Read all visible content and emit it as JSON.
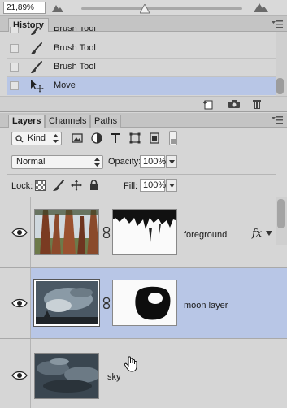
{
  "topbar": {
    "zoom_value": "21,89%",
    "icons": [
      "navigator-mountain-small-icon",
      "zoom-slider",
      "navigator-mountain-large-icon"
    ]
  },
  "history": {
    "tab_label": "History",
    "items": [
      {
        "label": "Brush Tool",
        "icon": "brush-icon",
        "selected": false
      },
      {
        "label": "Brush Tool",
        "icon": "brush-icon",
        "selected": false
      },
      {
        "label": "Brush Tool",
        "icon": "brush-icon",
        "selected": false
      },
      {
        "label": "Move",
        "icon": "move-icon",
        "selected": true
      }
    ],
    "footer_icons": [
      "new-document-from-state-icon",
      "snapshot-camera-icon",
      "trash-icon"
    ]
  },
  "layers": {
    "tabs": [
      {
        "label": "Layers",
        "active": true
      },
      {
        "label": "Channels",
        "active": false
      },
      {
        "label": "Paths",
        "active": false
      }
    ],
    "filter_kind_label": "Kind",
    "filter_icons": [
      "pixel-filter-icon",
      "adjustment-filter-icon",
      "type-filter-icon",
      "shape-filter-icon",
      "smart-object-filter-icon"
    ],
    "blend_mode": "Normal",
    "opacity_label": "Opacity:",
    "opacity_value": "100%",
    "lock_label": "Lock:",
    "lock_icons": [
      "lock-transparent-icon",
      "lock-image-icon",
      "lock-position-icon",
      "lock-all-icon"
    ],
    "fill_label": "Fill:",
    "fill_value": "100%",
    "list": [
      {
        "name": "foreground",
        "selected": false,
        "has_mask": true,
        "fx": "fx"
      },
      {
        "name": "moon layer",
        "selected": true,
        "has_mask": true,
        "fx": ""
      },
      {
        "name": "sky",
        "selected": false,
        "has_mask": false,
        "fx": ""
      }
    ]
  },
  "colors": {
    "selected_row": "#b8c6e6",
    "panel_bg": "#d6d6d6",
    "tab_bar": "#c4c4c4"
  }
}
